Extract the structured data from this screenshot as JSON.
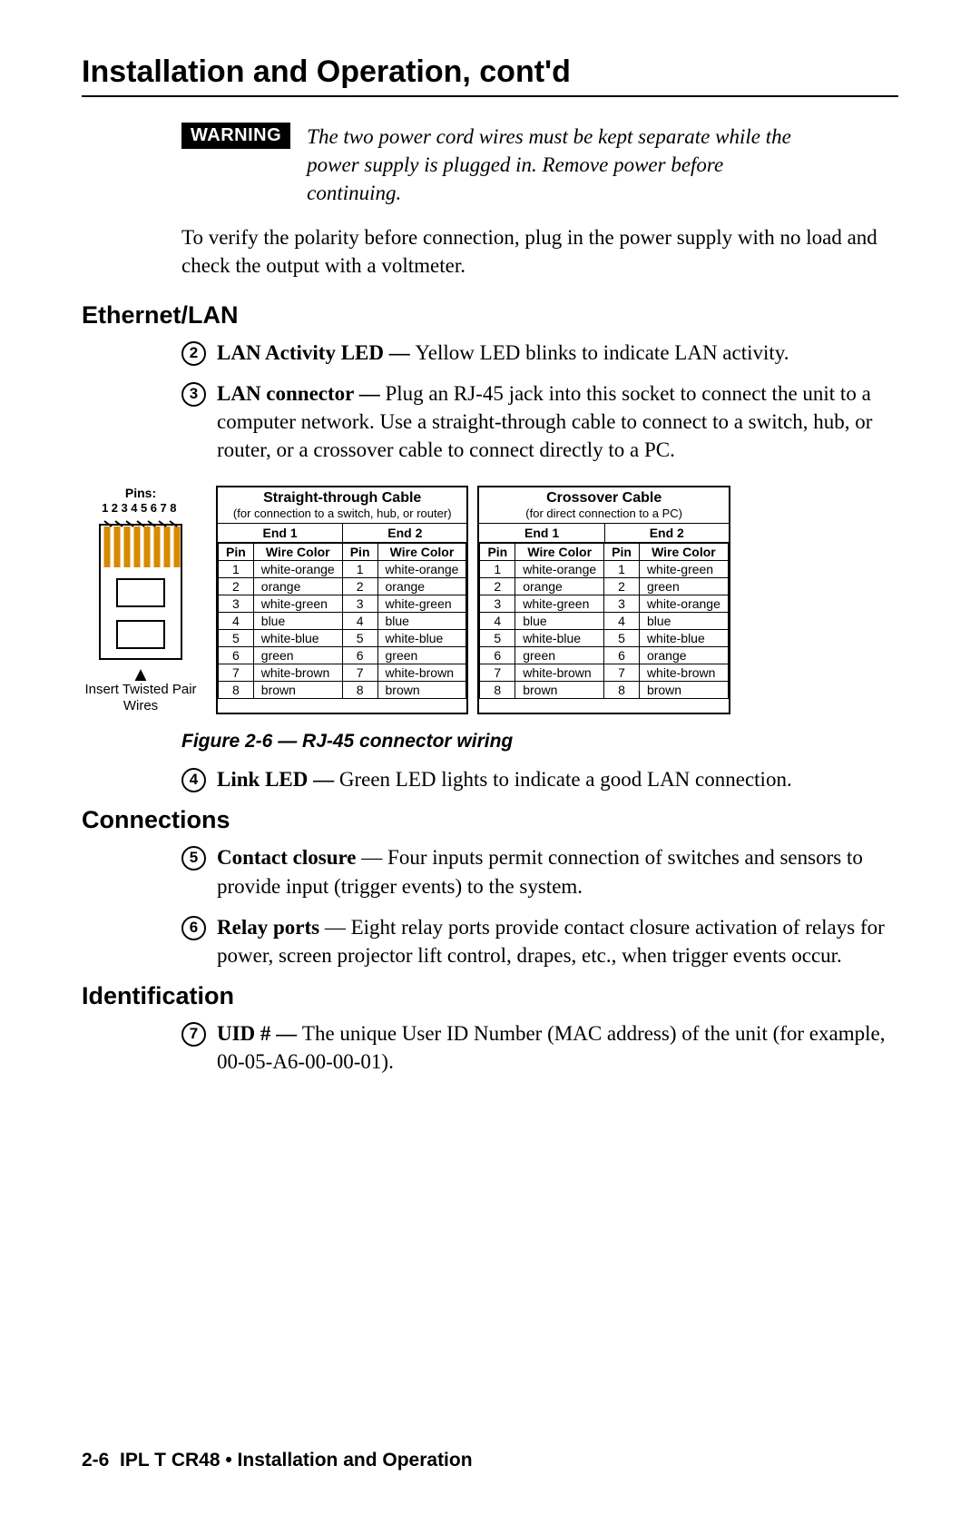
{
  "title": "Installation and Operation, cont'd",
  "warning": {
    "badge": "WARNING",
    "text": "The two power cord wires must be kept separate while the power supply is plugged in.  Remove power before continuing."
  },
  "verify_para": "To verify the polarity before connection, plug in the power supply with no load and check the output with a voltmeter.",
  "sections": {
    "ethernet": "Ethernet/LAN",
    "connections": "Connections",
    "identification": "Identification"
  },
  "items": {
    "2": {
      "num": "2",
      "label": "LAN Activity LED — ",
      "text": "Yellow LED blinks to indicate LAN activity."
    },
    "3": {
      "num": "3",
      "label": "LAN connector — ",
      "text": "Plug an RJ-45 jack into this socket to connect the unit to a computer network.  Use a straight-through cable to connect to a switch, hub, or router, or a crossover cable to connect directly to a PC."
    },
    "4": {
      "num": "4",
      "label": "Link LED — ",
      "text": "Green LED lights to indicate a good LAN connection."
    },
    "5": {
      "num": "5",
      "label": "Contact closure",
      "text": " — Four inputs permit connection of switches and sensors to provide input (trigger events) to the system."
    },
    "6": {
      "num": "6",
      "label": "Relay ports",
      "text": " — Eight relay ports provide contact closure activation of relays for power, screen projector lift control, drapes, etc., when trigger events occur."
    },
    "7": {
      "num": "7",
      "label": "UID # — ",
      "text": "The unique User ID Number (MAC address) of the unit (for example, 00-05-A6-00-00-01)."
    }
  },
  "rj45": {
    "pins_label": "Pins:",
    "pins_nums": "12345678",
    "arrow_text": "Insert Twisted Pair Wires"
  },
  "figure_caption": "Figure 2-6 — RJ-45 connector wiring",
  "tables": {
    "straight": {
      "title": "Straight-through Cable",
      "sub": "(for connection to a switch, hub, or router)",
      "end1": "End 1",
      "end2": "End 2",
      "cols": {
        "pin": "Pin",
        "color": "Wire Color"
      },
      "rows": [
        {
          "p1": "1",
          "c1": "white-orange",
          "p2": "1",
          "c2": "white-orange"
        },
        {
          "p1": "2",
          "c1": "orange",
          "p2": "2",
          "c2": "orange"
        },
        {
          "p1": "3",
          "c1": "white-green",
          "p2": "3",
          "c2": "white-green"
        },
        {
          "p1": "4",
          "c1": "blue",
          "p2": "4",
          "c2": "blue"
        },
        {
          "p1": "5",
          "c1": "white-blue",
          "p2": "5",
          "c2": "white-blue"
        },
        {
          "p1": "6",
          "c1": "green",
          "p2": "6",
          "c2": "green"
        },
        {
          "p1": "7",
          "c1": "white-brown",
          "p2": "7",
          "c2": "white-brown"
        },
        {
          "p1": "8",
          "c1": "brown",
          "p2": "8",
          "c2": "brown"
        }
      ]
    },
    "crossover": {
      "title": "Crossover Cable",
      "sub": "(for direct connection to a PC)",
      "end1": "End 1",
      "end2": "End 2",
      "cols": {
        "pin": "Pin",
        "color": "Wire Color"
      },
      "rows": [
        {
          "p1": "1",
          "c1": "white-orange",
          "p2": "1",
          "c2": "white-green"
        },
        {
          "p1": "2",
          "c1": "orange",
          "p2": "2",
          "c2": "green"
        },
        {
          "p1": "3",
          "c1": "white-green",
          "p2": "3",
          "c2": "white-orange"
        },
        {
          "p1": "4",
          "c1": "blue",
          "p2": "4",
          "c2": "blue"
        },
        {
          "p1": "5",
          "c1": "white-blue",
          "p2": "5",
          "c2": "white-blue"
        },
        {
          "p1": "6",
          "c1": "green",
          "p2": "6",
          "c2": "orange"
        },
        {
          "p1": "7",
          "c1": "white-brown",
          "p2": "7",
          "c2": "white-brown"
        },
        {
          "p1": "8",
          "c1": "brown",
          "p2": "8",
          "c2": "brown"
        }
      ]
    }
  },
  "footer": {
    "page": "2-6",
    "title": "IPL T CR48 • Installation and Operation"
  }
}
